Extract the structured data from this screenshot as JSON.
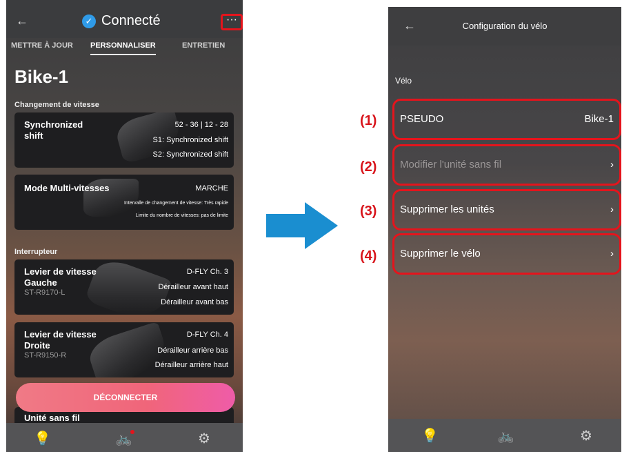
{
  "left": {
    "status": "Connecté",
    "more_icon": "more-dots-icon",
    "tabs": [
      "METTRE À JOUR",
      "PERSONNALISER",
      "ENTRETIEN"
    ],
    "bike_name": "Bike-1",
    "section_shift": "Changement de vitesse",
    "card1": {
      "title": "Synchronized shift",
      "r1": "52 - 36 | 12 - 28",
      "r2": "S1: Synchronized shift",
      "r3": "S2: Synchronized shift"
    },
    "card2": {
      "title": "Mode Multi-vitesses",
      "r1": "MARCHE",
      "r2": "Intervalle de changement de vitesse: Très rapide",
      "r3": "Limite du nombre de vitesses: pas de limite"
    },
    "section_switch": "Interrupteur",
    "card3": {
      "title": "Levier de vitesse Gauche",
      "sub": "ST-R9170-L",
      "r1": "D-FLY Ch. 3",
      "r2": "Dérailleur avant haut",
      "r3": "Dérailleur avant bas"
    },
    "card4": {
      "title": "Levier de vitesse Droite",
      "sub": "ST-R9150-R",
      "r1": "D-FLY Ch. 4",
      "r2": "Dérailleur arrière bas",
      "r3": "Dérailleur arrière haut"
    },
    "disconnect": "DÉCONNECTER",
    "card5_title": "Unité sans fil"
  },
  "right": {
    "title": "Configuration du vélo",
    "section": "Vélo",
    "rows": [
      {
        "num": "(1)",
        "label": "PSEUDO",
        "value": "Bike-1"
      },
      {
        "num": "(2)",
        "label": "Modifier l'unité sans fil",
        "value": "›"
      },
      {
        "num": "(3)",
        "label": "Supprimer les unités",
        "value": "›"
      },
      {
        "num": "(4)",
        "label": "Supprimer le vélo",
        "value": "›"
      }
    ]
  },
  "common": {
    "back": "←",
    "check": "✓",
    "more": "···",
    "nav_bulb": "💡",
    "nav_bike": "🚲",
    "nav_gear": "⚙"
  },
  "colors": {
    "highlight": "#e5141c",
    "arrow": "#1a8ed0",
    "check": "#2f9be8",
    "disconnect": "#f0657a"
  }
}
